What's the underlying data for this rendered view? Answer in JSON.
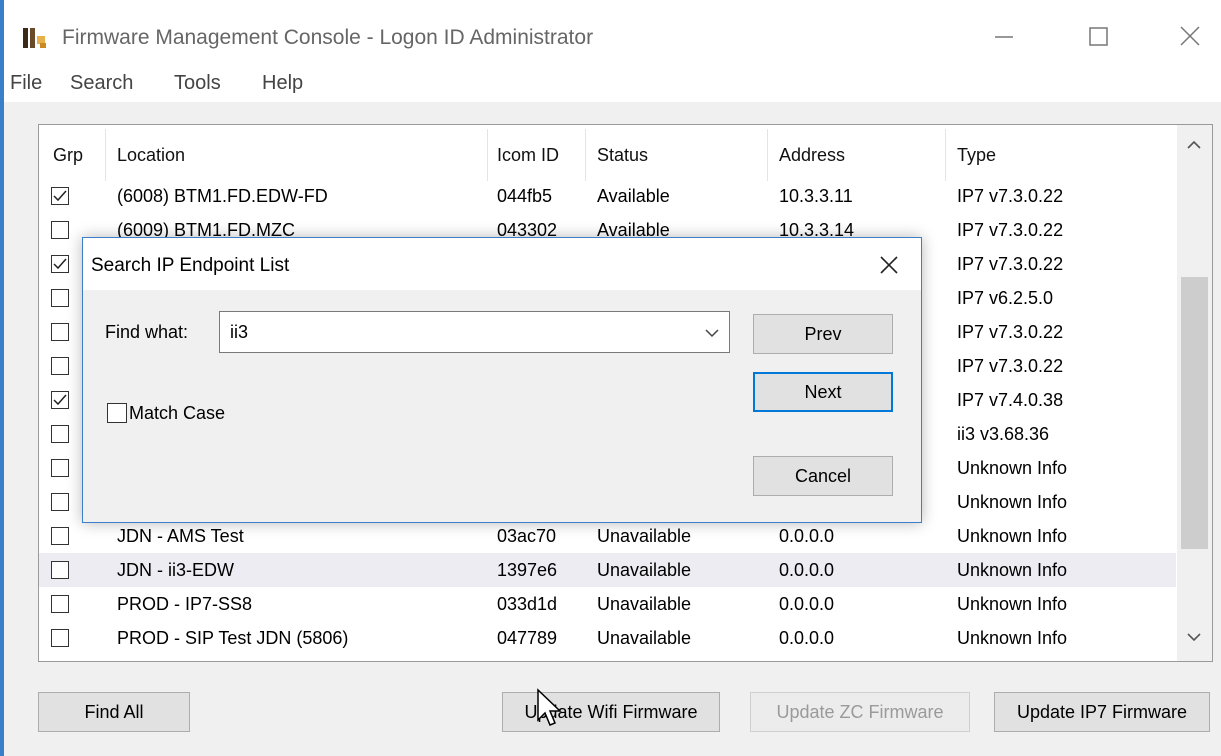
{
  "window": {
    "title": "Firmware Management Console - Logon ID Administrator",
    "controls": {
      "minimize": "—",
      "maximize": "☐",
      "close": "✕"
    }
  },
  "menu": [
    "File",
    "Search",
    "Tools",
    "Help"
  ],
  "table": {
    "columns": [
      "Grp",
      "Location",
      "Icom ID",
      "Status",
      "Address",
      "Type"
    ],
    "rows": [
      {
        "checked": true,
        "location": "(6008) BTM1.FD.EDW-FD",
        "icom": "044fb5",
        "status": "Available",
        "address": "10.3.3.11",
        "type": "IP7 v7.3.0.22"
      },
      {
        "checked": false,
        "location": "(6009) BTM1.FD.MZC",
        "icom": "043302",
        "status": "Available",
        "address": "10.3.3.14",
        "type": "IP7 v7.3.0.22"
      },
      {
        "checked": true,
        "location": "",
        "icom": "",
        "status": "",
        "address": "",
        "type": "IP7 v7.3.0.22"
      },
      {
        "checked": false,
        "location": "",
        "icom": "",
        "status": "",
        "address": "",
        "type": "IP7 v6.2.5.0"
      },
      {
        "checked": false,
        "location": "",
        "icom": "",
        "status": "",
        "address": "",
        "type": "IP7 v7.3.0.22"
      },
      {
        "checked": false,
        "location": "",
        "icom": "",
        "status": "",
        "address": "",
        "type": "IP7 v7.3.0.22"
      },
      {
        "checked": true,
        "location": "",
        "icom": "",
        "status": "",
        "address": "",
        "type": "IP7 v7.4.0.38"
      },
      {
        "checked": false,
        "location": "",
        "icom": "",
        "status": "",
        "address": "",
        "type": "ii3 v3.68.36"
      },
      {
        "checked": false,
        "location": "",
        "icom": "",
        "status": "",
        "address": "",
        "type": "Unknown Info"
      },
      {
        "checked": false,
        "location": "",
        "icom": "",
        "status": "",
        "address": "",
        "type": "Unknown Info"
      },
      {
        "checked": false,
        "location": "JDN - AMS Test",
        "icom": "03ac70",
        "status": "Unavailable",
        "address": "0.0.0.0",
        "type": "Unknown Info"
      },
      {
        "checked": false,
        "location": "JDN - ii3-EDW",
        "icom": "1397e6",
        "status": "Unavailable",
        "address": "0.0.0.0",
        "type": "Unknown Info",
        "highlight": true
      },
      {
        "checked": false,
        "location": "PROD - IP7-SS8",
        "icom": "033d1d",
        "status": "Unavailable",
        "address": "0.0.0.0",
        "type": "Unknown Info"
      },
      {
        "checked": false,
        "location": "PROD - SIP Test JDN (5806)",
        "icom": "047789",
        "status": "Unavailable",
        "address": "0.0.0.0",
        "type": "Unknown Info"
      }
    ]
  },
  "buttons": {
    "find_all": "Find All",
    "update_wifi": "Update Wifi Firmware",
    "update_zc": "Update ZC Firmware",
    "update_ip7": "Update IP7 Firmware"
  },
  "dialog": {
    "title": "Search IP Endpoint List",
    "find_label": "Find what:",
    "find_value": "ii3",
    "match_case": "Match Case",
    "prev": "Prev",
    "next": "Next",
    "cancel": "Cancel"
  },
  "colors": {
    "accent": "#3a7fc7",
    "focus": "#0078d7"
  }
}
